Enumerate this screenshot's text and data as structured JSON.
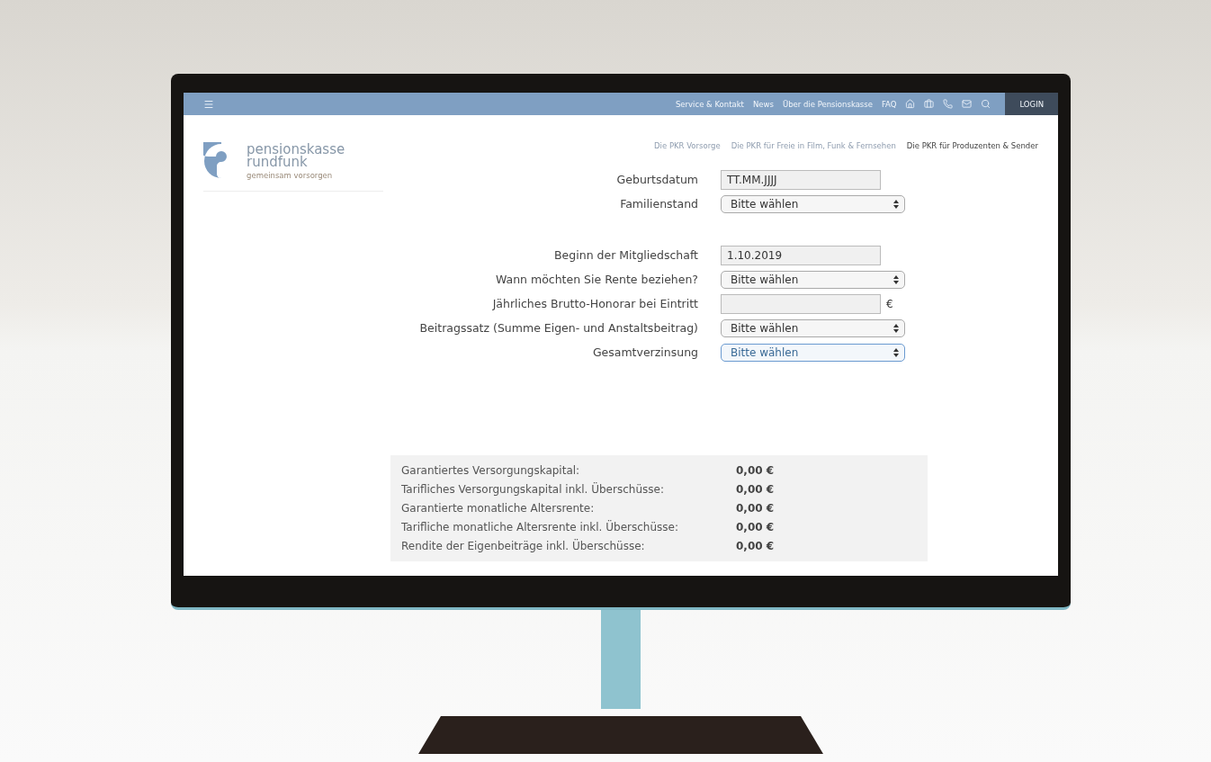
{
  "nav": {
    "links": [
      "Service & Kontakt",
      "News",
      "Über die Pensionskasse",
      "FAQ"
    ],
    "login": "LOGIN"
  },
  "logo": {
    "line_1": "pensionskasse",
    "line_2": "rundfunk",
    "tagline": "gemeinsam vorsorgen"
  },
  "subnav": [
    {
      "label": "Die PKR Vorsorge",
      "selected": false
    },
    {
      "label": "Die PKR für Freie in Film, Funk & Fernsehen",
      "selected": false
    },
    {
      "label": "Die PKR für Produzenten & Sender",
      "selected": true
    }
  ],
  "form": {
    "sections": [
      [
        {
          "label": "Geburtsdatum",
          "kind": "text",
          "placeholder": "TT.MM.JJJJ",
          "focused": false
        },
        {
          "label": "Familienstand",
          "kind": "select",
          "value": "Bitte wählen",
          "focused": false
        }
      ],
      [
        {
          "label": "Beginn der Mitgliedschaft",
          "kind": "text",
          "value": "1.10.2019",
          "focused": false
        },
        {
          "label": "Wann möchten Sie Rente beziehen?",
          "kind": "select",
          "value": "Bitte wählen",
          "focused": false
        },
        {
          "label": "Jährliches Brutto-Honorar bei Eintritt",
          "kind": "text",
          "unit": "€",
          "focused": false
        },
        {
          "label": "Beitragssatz (Summe Eigen- und Anstaltsbeitrag)",
          "kind": "select",
          "value": "Bitte wählen",
          "focused": false
        },
        {
          "label": "Gesamtverzinsung",
          "kind": "select",
          "value": "Bitte wählen",
          "focused": true
        }
      ]
    ]
  },
  "results": [
    {
      "label": "Garantiertes Versorgungskapital:",
      "value": "0,00 €"
    },
    {
      "label": "Tarifliches Versorgungskapital inkl. Überschüsse:",
      "value": "0,00 €"
    },
    {
      "label": "Garantierte monatliche Altersrente:",
      "value": "0,00 €"
    },
    {
      "label": "Tarifliche monatliche Altersrente inkl. Überschüsse:",
      "value": "0,00 €"
    },
    {
      "label": "Rendite der Eigenbeiträge inkl. Überschüsse:",
      "value": "0,00 €"
    }
  ]
}
